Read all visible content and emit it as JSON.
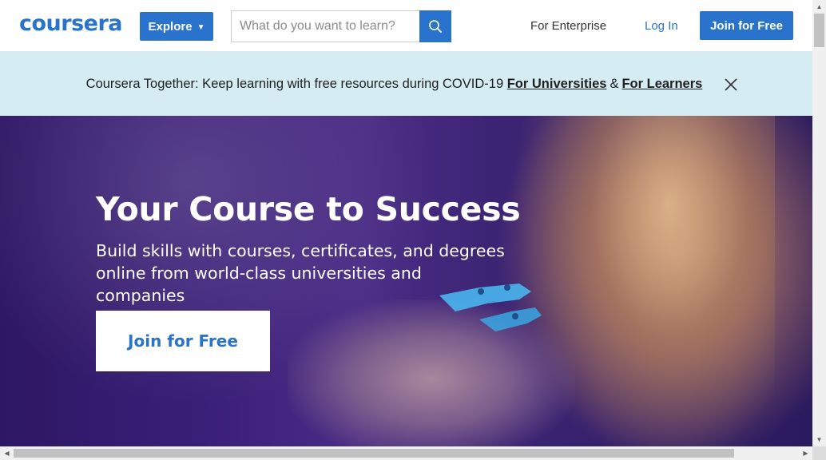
{
  "header": {
    "logo": "coursera",
    "explore_label": "Explore",
    "search_placeholder": "What do you want to learn?",
    "enterprise_label": "For Enterprise",
    "login_label": "Log In",
    "join_label": "Join for Free"
  },
  "banner": {
    "text": "Coursera Together: Keep learning with free resources during COVID-19",
    "link_universities": "For Universities",
    "ampersand": "&",
    "link_learners": "For Learners"
  },
  "hero": {
    "title": "Your Course to Success",
    "subtitle": "Build skills with courses, certificates, and degrees online from world-class universities and companies",
    "cta_label": "Join for Free"
  },
  "colors": {
    "brand": "#2a73cc",
    "banner_bg": "#d6ecf3",
    "hero_bg": "#3a1f78"
  }
}
